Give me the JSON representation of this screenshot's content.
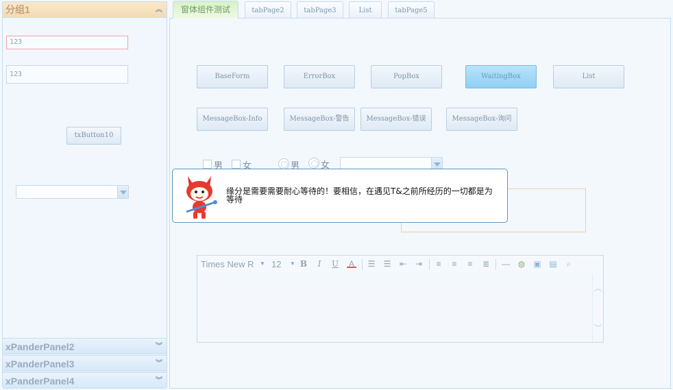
{
  "left_panel": {
    "group1_title": "分组1",
    "textbox1_value": "123",
    "textbox2_value": "123",
    "button_label": "txButton10",
    "panels": [
      "xPanderPanel2",
      "xPanderPanel3",
      "xPanderPanel4"
    ]
  },
  "tabs": [
    "窗体组件测试",
    "tabPage2",
    "tabPage3",
    "List",
    "tabPage5"
  ],
  "buttons_row1": [
    "BaseForm",
    "ErrorBox",
    "PopBox",
    "WaitingBox",
    "List"
  ],
  "buttons_row2": [
    "MessageBox-Info",
    "MessageBox-警告",
    "MessageBox-错误",
    "MessageBox-询问"
  ],
  "checkboxes": [
    "男",
    "女"
  ],
  "radios": [
    "男",
    "女"
  ],
  "editor_toolbar": {
    "font_name": "Times New R",
    "font_size": "12",
    "bold": "B",
    "italic": "I",
    "underline": "U",
    "font_color": "A"
  },
  "popup": {
    "message": "缘分是需要需要耐心等待的！要相信，在遇见T&之前所经历的一切都是为等待",
    "mascot_icon": "fox-mascot-icon"
  },
  "colors": {
    "accent_selected_button": "#8fd0f4",
    "active_tab": "#d8f2c6",
    "popup_border": "#5d94bb"
  }
}
